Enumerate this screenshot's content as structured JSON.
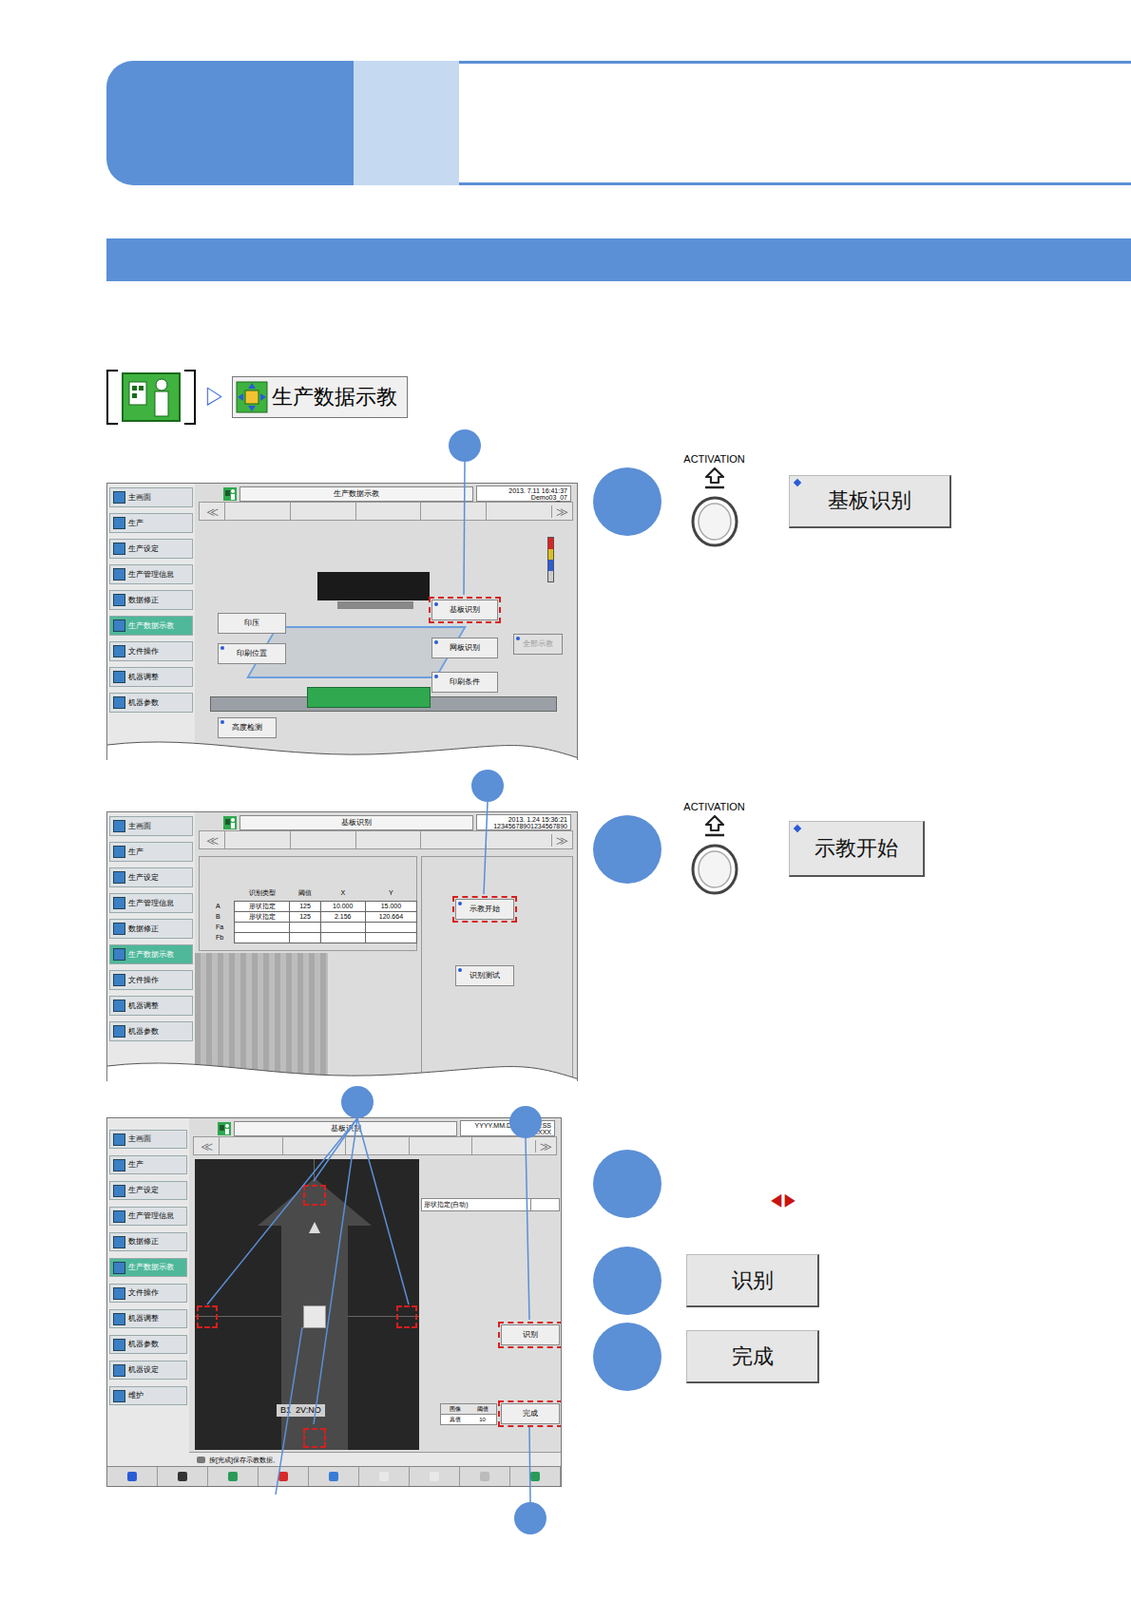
{
  "breadcrumb": {
    "separator": "▷",
    "item": "生产数据示教"
  },
  "screens": [
    {
      "title": "生产数据示教",
      "datetime": "2013. 7.11 16:41:37",
      "model": "Demo03_07",
      "nav": {
        "prev": "≪",
        "next": "≫"
      },
      "sidebar": [
        {
          "label": "主画面",
          "selected": false
        },
        {
          "label": "生产",
          "selected": false
        },
        {
          "label": "生产设定",
          "selected": false
        },
        {
          "label": "生产管理信息",
          "selected": false
        },
        {
          "label": "数据修正",
          "selected": false
        },
        {
          "label": "生产数据示教",
          "selected": true
        },
        {
          "label": "文件操作",
          "selected": false
        },
        {
          "label": "机器调整",
          "selected": false
        },
        {
          "label": "机器参数",
          "selected": false
        }
      ],
      "buttons": [
        {
          "label": "印压",
          "marker": false,
          "highlighted": false,
          "disabled": false
        },
        {
          "label": "基板识别",
          "marker": true,
          "highlighted": true,
          "disabled": false
        },
        {
          "label": "网板识别",
          "marker": true,
          "highlighted": false,
          "disabled": false
        },
        {
          "label": "全部示教",
          "marker": true,
          "highlighted": false,
          "disabled": true
        },
        {
          "label": "印刷位置",
          "marker": true,
          "highlighted": false,
          "disabled": false
        },
        {
          "label": "印刷条件",
          "marker": true,
          "highlighted": false,
          "disabled": false
        },
        {
          "label": "高度检测",
          "marker": true,
          "highlighted": false,
          "disabled": false
        }
      ]
    },
    {
      "title": "基板识别",
      "datetime": "2013. 1.24 15:36:21",
      "model": "12345678901234567890",
      "nav": {
        "prev": "≪",
        "next": "≫"
      },
      "sidebar": [
        {
          "label": "主画面",
          "selected": false
        },
        {
          "label": "生产",
          "selected": false
        },
        {
          "label": "生产设定",
          "selected": false
        },
        {
          "label": "生产管理信息",
          "selected": false
        },
        {
          "label": "数据修正",
          "selected": false
        },
        {
          "label": "生产数据示教",
          "selected": true
        },
        {
          "label": "文件操作",
          "selected": false
        },
        {
          "label": "机器调整",
          "selected": false
        },
        {
          "label": "机器参数",
          "selected": false
        }
      ],
      "table": {
        "columns": [
          "",
          "识别类型",
          "阈值",
          "X",
          "Y"
        ],
        "rows": [
          [
            "A",
            "形状指定",
            "125",
            "10.000",
            "15.000"
          ],
          [
            "B",
            "形状指定",
            "125",
            "2.156",
            "120.664"
          ],
          [
            "Fa",
            "",
            "",
            "",
            ""
          ],
          [
            "Fb",
            "",
            "",
            "",
            ""
          ]
        ]
      },
      "buttons": [
        {
          "label": "示教开始",
          "marker": true,
          "highlighted": true,
          "disabled": false
        },
        {
          "label": "识别测试",
          "marker": true,
          "highlighted": false,
          "disabled": false
        }
      ]
    },
    {
      "title": "基板识别",
      "datetime": "YYYY.MM.DD HH:MM:SS",
      "model": "XXXXXXXX",
      "nav": {
        "prev": "≪",
        "next": "≫"
      },
      "sidebar": [
        {
          "label": "主画面",
          "selected": false
        },
        {
          "label": "生产",
          "selected": false
        },
        {
          "label": "生产设定",
          "selected": false
        },
        {
          "label": "生产管理信息",
          "selected": false
        },
        {
          "label": "数据修正",
          "selected": false
        },
        {
          "label": "生产数据示教",
          "selected": true
        },
        {
          "label": "文件操作",
          "selected": false
        },
        {
          "label": "机器调整",
          "selected": false
        },
        {
          "label": "机器参数",
          "selected": false
        },
        {
          "label": "机器设定",
          "selected": false
        },
        {
          "label": "维护",
          "selected": false
        }
      ],
      "mode": "形状指定(自动)",
      "camera_label": "B1  2V:NO",
      "mini_table": {
        "columns": [
          "图像",
          "阈值"
        ],
        "values": [
          "真值",
          "10"
        ]
      },
      "buttons": [
        {
          "label": "识别",
          "marker": false,
          "highlighted": true,
          "disabled": false
        },
        {
          "label": "完成",
          "marker": false,
          "highlighted": true,
          "disabled": false
        }
      ],
      "message": "按[完成]保存示教数据。"
    }
  ],
  "steps": [
    {
      "kind": "activation",
      "caption": "ACTIVATION",
      "button": "基板识别",
      "marker": true
    },
    {
      "kind": "activation",
      "caption": "ACTIVATION",
      "button": "示教开始",
      "marker": true
    },
    {
      "kind": "arrows",
      "text": "◀▶"
    },
    {
      "kind": "button",
      "button": "识别",
      "marker": false
    },
    {
      "kind": "button",
      "button": "完成",
      "marker": false
    }
  ]
}
